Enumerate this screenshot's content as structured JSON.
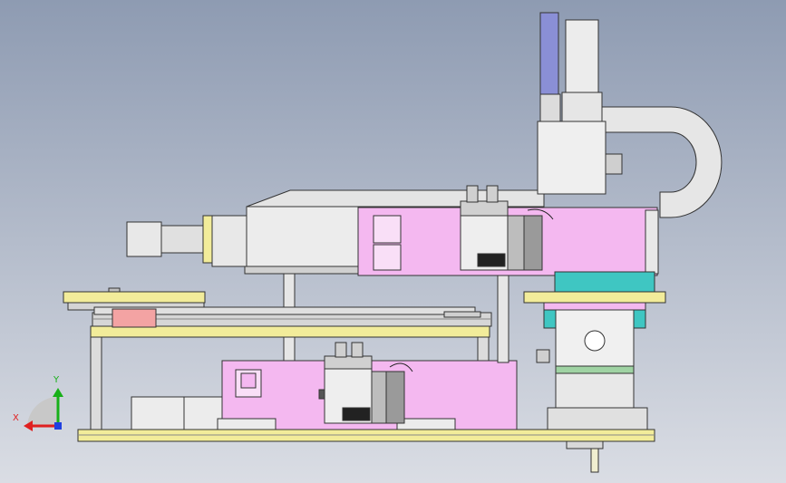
{
  "view": {
    "background_top": "#8e9bb2",
    "background_bottom": "#dadde4"
  },
  "colors": {
    "magenta_panel": "#f4b8f0",
    "yellow_plate": "#f2ec9a",
    "gray_part": "#e8e8e8",
    "teal_accent": "#3fc6c2",
    "blue_motor": "#8a8fd6",
    "salmon_block": "#f3a3a3",
    "green_rail": "#9fd3a3"
  },
  "triad": {
    "x_label": "X",
    "y_label": "Y",
    "x_color": "#e02020",
    "y_color": "#18b018",
    "z_color": "#2040e0"
  }
}
